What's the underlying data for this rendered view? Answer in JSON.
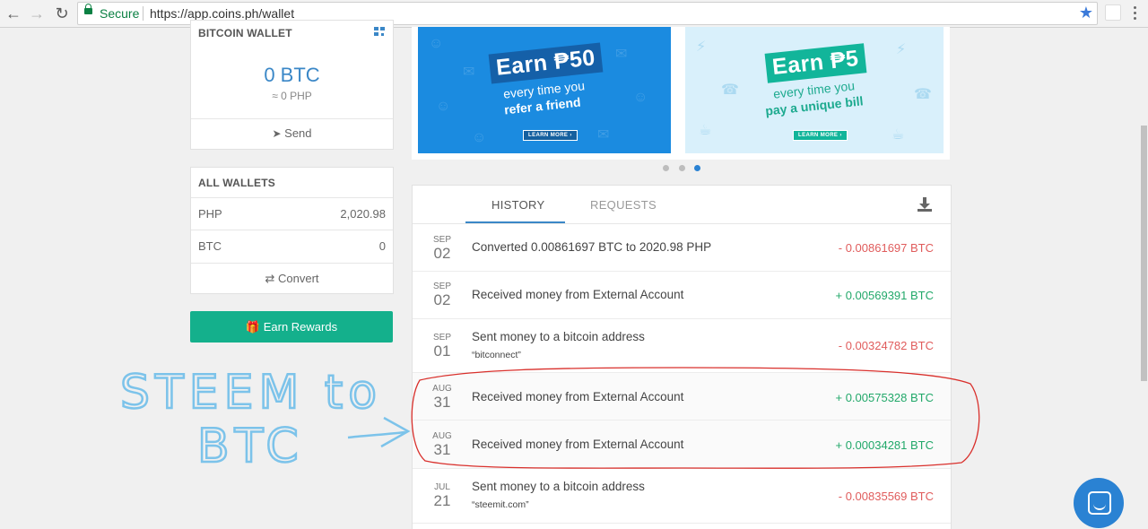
{
  "browser": {
    "back_icon": "arrow-left-icon",
    "forward_icon": "arrow-right-icon",
    "reload_icon": "reload-icon",
    "secure_label": "Secure",
    "url": "https://app.coins.ph/wallet",
    "star_color": "#3b7ad9"
  },
  "bitcoin_wallet": {
    "title": "BITCOIN WALLET",
    "amount": "0 BTC",
    "php_equiv": "≈ 0 PHP",
    "send_label": "Send"
  },
  "all_wallets": {
    "title": "ALL WALLETS",
    "rows": [
      {
        "label": "PHP",
        "value": "2,020.98"
      },
      {
        "label": "BTC",
        "value": "0"
      }
    ],
    "convert_label": "Convert"
  },
  "earn_rewards": {
    "label": "Earn Rewards",
    "color": "#14b08c"
  },
  "banners": [
    {
      "headline": "Earn ₱50",
      "line1": "every time you",
      "line2": "refer a friend",
      "cta": "LEARN MORE ›"
    },
    {
      "headline": "Earn ₱5",
      "line1": "every time you",
      "line2": "pay a unique bill",
      "cta": "LEARN MORE ›"
    }
  ],
  "carousel": {
    "count": 3,
    "active_index": 3
  },
  "history": {
    "tabs": [
      "HISTORY",
      "REQUESTS"
    ],
    "active_tab": "HISTORY",
    "transactions": [
      {
        "month": "SEP",
        "day": "02",
        "desc": "Converted 0.00861697 BTC to 2020.98 PHP",
        "note": "",
        "amount": "- 0.00861697 BTC",
        "direction": "out"
      },
      {
        "month": "SEP",
        "day": "02",
        "desc": "Received money from External Account",
        "note": "",
        "amount": "+ 0.00569391 BTC",
        "direction": "in"
      },
      {
        "month": "SEP",
        "day": "01",
        "desc": "Sent money to a bitcoin address",
        "note": "“bitconnect”",
        "amount": "- 0.00324782 BTC",
        "direction": "out"
      },
      {
        "month": "AUG",
        "day": "31",
        "desc": "Received money from External Account",
        "note": "",
        "amount": "+ 0.00575328 BTC",
        "direction": "in"
      },
      {
        "month": "AUG",
        "day": "31",
        "desc": "Received money from External Account",
        "note": "",
        "amount": "+ 0.00034281 BTC",
        "direction": "in"
      },
      {
        "month": "JUL",
        "day": "21",
        "desc": "Sent money to a bitcoin address",
        "note": "“steemit.com”",
        "amount": "- 0.00835569 BTC",
        "direction": "out"
      }
    ],
    "negative_color": "#e05c5c",
    "positive_color": "#22a86a"
  },
  "annotation": {
    "line1": "STEEM to",
    "line2": "BTC",
    "ink_color": "#7cc3ea",
    "circle_color": "#d9302c"
  },
  "chat": {
    "icon": "chat-icon",
    "color": "#2a82d3"
  }
}
